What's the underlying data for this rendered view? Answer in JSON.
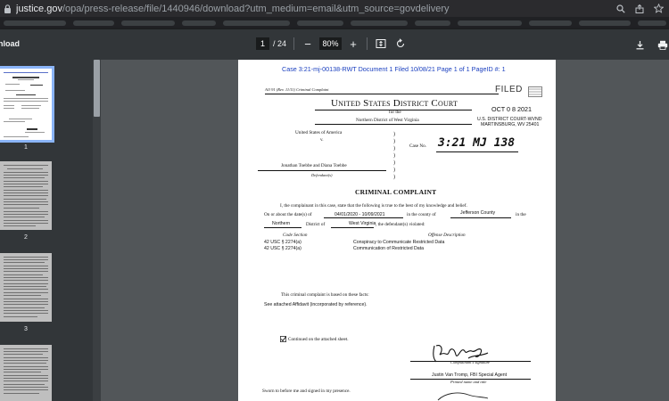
{
  "browser": {
    "url_domain": "justice.gov",
    "url_path": "/opa/press-release/file/1440946/download?utm_medium=email&utm_source=govdelivery"
  },
  "viewer": {
    "title": "nload",
    "current_page": "1",
    "page_count": "/ 24",
    "zoom": "80%",
    "zoom_out_label": "−",
    "zoom_in_label": "+"
  },
  "thumbnails": [
    {
      "label": "1"
    },
    {
      "label": "2"
    },
    {
      "label": "3"
    }
  ],
  "document": {
    "ecf_header": "Case 3:21-mj-00138-RWT   Document 1   Filed 10/08/21   Page 1 of 1  PageID #: 1",
    "form_number": "AO 91 (Rev. 11/11)   Criminal Complaint",
    "court_name": "United States District Court",
    "for_the": "for the",
    "district": "Northern District of West Virginia",
    "filed_stamp": "FILED",
    "filed_date": "OCT 0 8 2021",
    "filed_court": "U.S. DISTRICT COURT-WVND",
    "filed_location": "MARTINSBURG, WV  25401",
    "plaintiff": "United States of America",
    "versus": "v.",
    "case_no_label": "Case No.",
    "case_no_value": "3:21 MJ 138",
    "defendants": "Jonathan Toebbe and Diana Toebbe",
    "defendants_label": "Defendant(s)",
    "complaint_title": "CRIMINAL COMPLAINT",
    "statement": "I, the complainant in this case, state that the following is true to the best of my knowledge and belief.",
    "on_or_about": "On or about the date(s) of",
    "dates": "04/01/2020 - 10/09/2021",
    "in_county_of": "in the county of",
    "county": "Jefferson County",
    "in_the": "in the",
    "district_dir": "Northern",
    "district_of": "District of",
    "state": "West Virginia",
    "violated": ", the defendant(s) violated:",
    "code_section_label": "Code Section",
    "offense_label": "Offense Description",
    "violations": [
      {
        "code": "42 USC § 2274(a)",
        "offense": "Conspiracy to Communicate Restricted Data"
      },
      {
        "code": "42 USC § 2274(a)",
        "offense": "Communication of Restricted Data"
      }
    ],
    "based_on": "This criminal complaint is based on these facts:",
    "see_attached": "See attached Affidavit (incorporated by reference).",
    "continued": "Continued on the attached sheet.",
    "complainant_sig_label": "Complainant's signature",
    "complainant_name": "Justin Van Tromp, FBI Special Agent",
    "printed_name_label": "Printed name and title",
    "sworn": "Sworn to before me and signed in my presence."
  }
}
